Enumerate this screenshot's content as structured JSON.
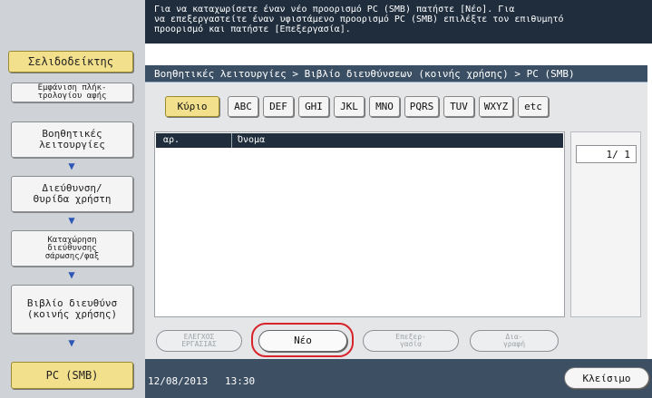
{
  "instruction_text": "Για να καταχωρίσετε έναν νέο προορισμό PC (SMB) πατήστε [Νέο]. Για\nνα επεξεργαστείτε έναν υφιστάμενο προορισμό PC (SMB) επιλέξτε τον επιθυμητό\nπροορισμό και πατήστε [Επεξεργασία].",
  "sidebar": {
    "tab_label": "Σελιδοδείκτης",
    "display_button": "Εμφάνιση πλήκ-\nτρολογίου αφής",
    "steps": [
      "Βοηθητικές\nλειτουργίες",
      "Διεύθυνση/\nΘυρίδα χρήστη",
      "Καταχώρηση\nδιεύθυνσης\nσάρωσης/φαξ",
      "Βιβλίο διευθύνσ\n(κοινής χρήσης)"
    ],
    "current_step": "PC (SMB)"
  },
  "breadcrumb": "Βοηθητικές λειτουργίες > Βιβλίο διευθύνσεων (κοινής χρήσης) > PC (SMB)",
  "index_tabs": [
    "Κύριο",
    "ABC",
    "DEF",
    "GHI",
    "JKL",
    "MNO",
    "PQRS",
    "TUV",
    "WXYZ",
    "etc"
  ],
  "list": {
    "columns": [
      "αρ.",
      "Όνομα"
    ]
  },
  "page_indicator": "1/  1",
  "actions": {
    "check_job": "ΕΛΕΓΧΟΣ\nΕΡΓΑΣΙΑΣ",
    "new": "Νέο",
    "edit": "Επεξερ-\nγασία",
    "delete": "Δια-\nγραφή"
  },
  "footer": {
    "date": "12/08/2013",
    "time": "13:30",
    "close": "Κλείσιμο"
  },
  "colors": {
    "accent_yellow": "#f2e08c",
    "header_dark": "#1f2d3d",
    "highlight_red": "#d8232a"
  }
}
